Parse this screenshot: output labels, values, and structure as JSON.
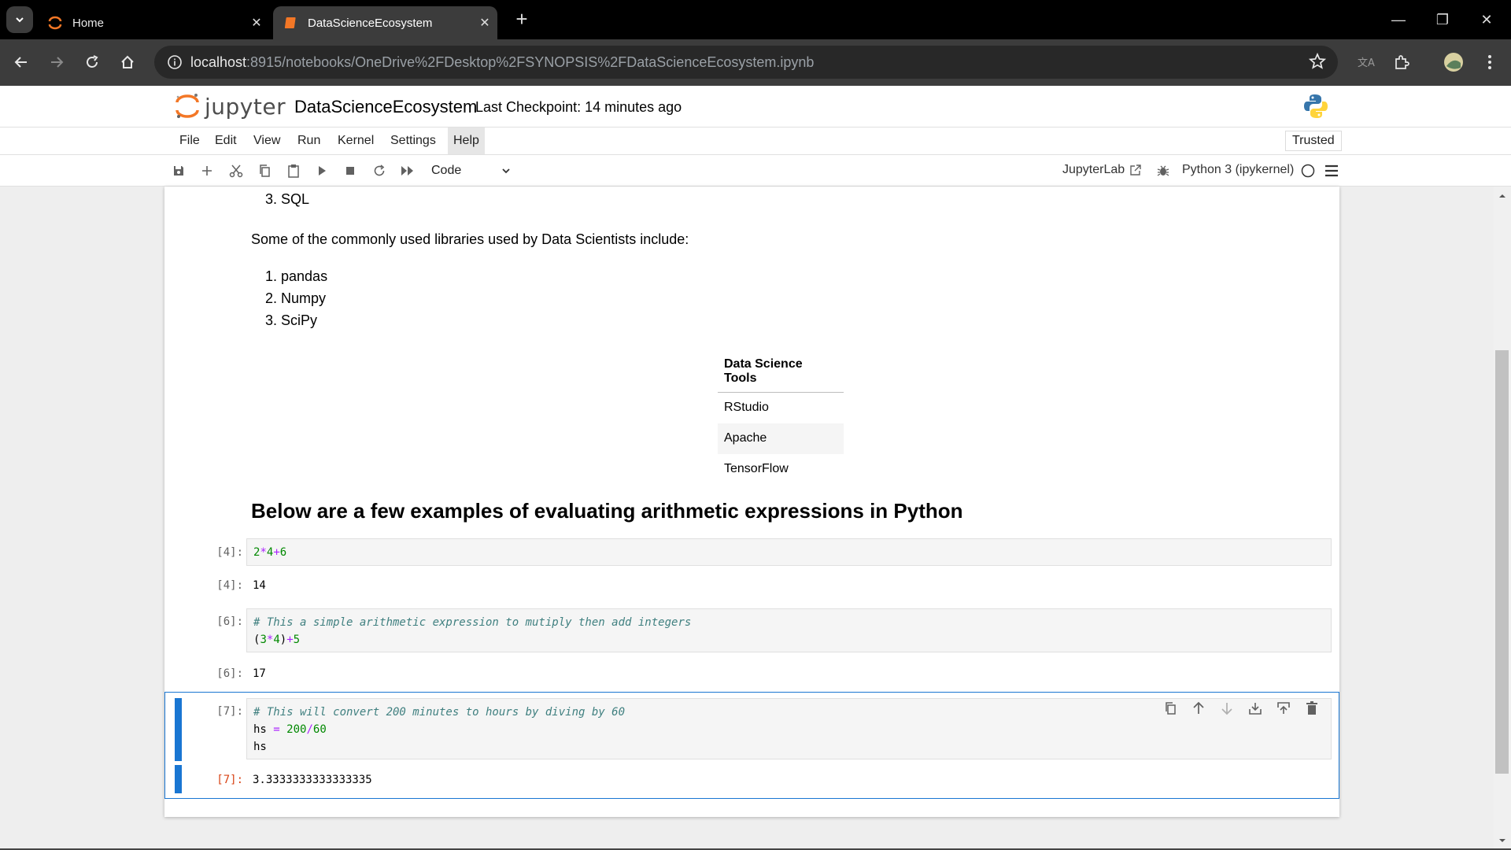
{
  "browser": {
    "tabs": [
      {
        "label": "Home"
      },
      {
        "label": "DataScienceEcosystem"
      }
    ],
    "url_host": "localhost",
    "url_rest": ":8915/notebooks/OneDrive%2FDesktop%2FSYNOPSIS%2FDataScienceEcosystem.ipynb"
  },
  "jupyter": {
    "logo_text": "jupyter",
    "notebook_title": "DataScienceEcosystem",
    "checkpoint": "Last Checkpoint: 14 minutes ago",
    "menu": [
      "File",
      "Edit",
      "View",
      "Run",
      "Kernel",
      "Settings",
      "Help"
    ],
    "trusted": "Trusted",
    "cell_type": "Code",
    "jupyterlab_link": "JupyterLab",
    "kernel_name": "Python 3 (ipykernel)"
  },
  "notebook": {
    "languages_tail": [
      "3. SQL"
    ],
    "libraries_intro": "Some of the commonly used libraries used by Data Scientists include:",
    "libraries": [
      "1. pandas",
      "2. Numpy",
      "3. SciPy"
    ],
    "tools_table": {
      "header": "Data Science Tools",
      "rows": [
        "RStudio",
        "Apache",
        "TensorFlow"
      ]
    },
    "heading": "Below are a few examples of evaluating arithmetic expressions in Python",
    "cells": [
      {
        "in_prompt": "[4]:",
        "code_lines": [
          "2*4+6"
        ],
        "out_prompt": "[4]:",
        "output": "14"
      },
      {
        "in_prompt": "[6]:",
        "code_lines": [
          "# This a simple arithmetic expression to mutiply then add integers",
          "(3*4)+5"
        ],
        "out_prompt": "[6]:",
        "output": "17"
      },
      {
        "in_prompt": "[7]:",
        "code_lines": [
          "# This will convert 200 minutes to hours by diving by 60",
          "hs = 200/60",
          "hs"
        ],
        "out_prompt": "[7]:",
        "output": "3.3333333333333335"
      }
    ]
  }
}
